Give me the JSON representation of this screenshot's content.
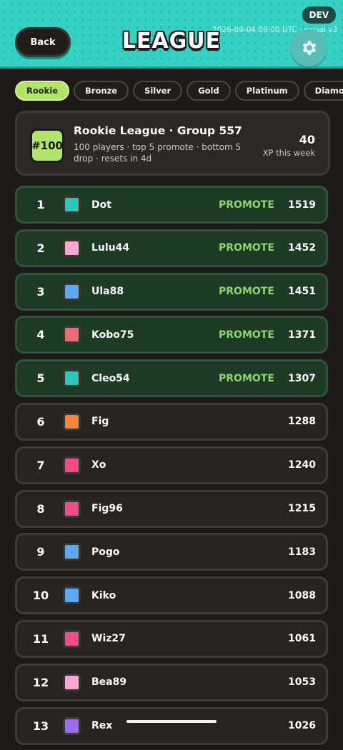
{
  "header": {
    "back_label": "Back",
    "title": "LEAGUE",
    "env_badge": "DEV",
    "stamp": "2026-09-04 09:00 UTC · social v3",
    "gear_icon": "gear-icon"
  },
  "tabs": [
    {
      "label": "Rookie",
      "active": true
    },
    {
      "label": "Bronze",
      "active": false
    },
    {
      "label": "Silver",
      "active": false
    },
    {
      "label": "Gold",
      "active": false
    },
    {
      "label": "Platinum",
      "active": false
    },
    {
      "label": "Diamond",
      "active": false
    },
    {
      "label": "",
      "active": false
    }
  ],
  "group": {
    "rank": "#100",
    "title": "Rookie League · Group 557",
    "subtitle": "100 players · top 5 promote · bottom 5 drop · resets in 4d",
    "xp_value": "40",
    "xp_label": "XP this week"
  },
  "leaderboard": [
    {
      "rank": "1",
      "name": "Dot",
      "status": "PROMOTE",
      "xp": "1519",
      "color": "#2ec4b6"
    },
    {
      "rank": "2",
      "name": "Lulu44",
      "status": "PROMOTE",
      "xp": "1452",
      "color": "#f7a8d0"
    },
    {
      "rank": "3",
      "name": "Ula88",
      "status": "PROMOTE",
      "xp": "1451",
      "color": "#5aa9f8"
    },
    {
      "rank": "4",
      "name": "Kobo75",
      "status": "PROMOTE",
      "xp": "1371",
      "color": "#ef6b73"
    },
    {
      "rank": "5",
      "name": "Cleo54",
      "status": "PROMOTE",
      "xp": "1307",
      "color": "#2ec4b6"
    },
    {
      "rank": "6",
      "name": "Fig",
      "status": "",
      "xp": "1288",
      "color": "#f6843a"
    },
    {
      "rank": "7",
      "name": "Xo",
      "status": "",
      "xp": "1240",
      "color": "#f24b8c"
    },
    {
      "rank": "8",
      "name": "Fig96",
      "status": "",
      "xp": "1215",
      "color": "#f24b8c"
    },
    {
      "rank": "9",
      "name": "Pogo",
      "status": "",
      "xp": "1183",
      "color": "#5aa9f8"
    },
    {
      "rank": "10",
      "name": "Kiko",
      "status": "",
      "xp": "1088",
      "color": "#5aa9f8"
    },
    {
      "rank": "11",
      "name": "Wiz27",
      "status": "",
      "xp": "1061",
      "color": "#f24b8c"
    },
    {
      "rank": "12",
      "name": "Bea89",
      "status": "",
      "xp": "1053",
      "color": "#f7a8d0"
    },
    {
      "rank": "13",
      "name": "Rex",
      "status": "",
      "xp": "1026",
      "color": "#9b6cf0"
    }
  ]
}
